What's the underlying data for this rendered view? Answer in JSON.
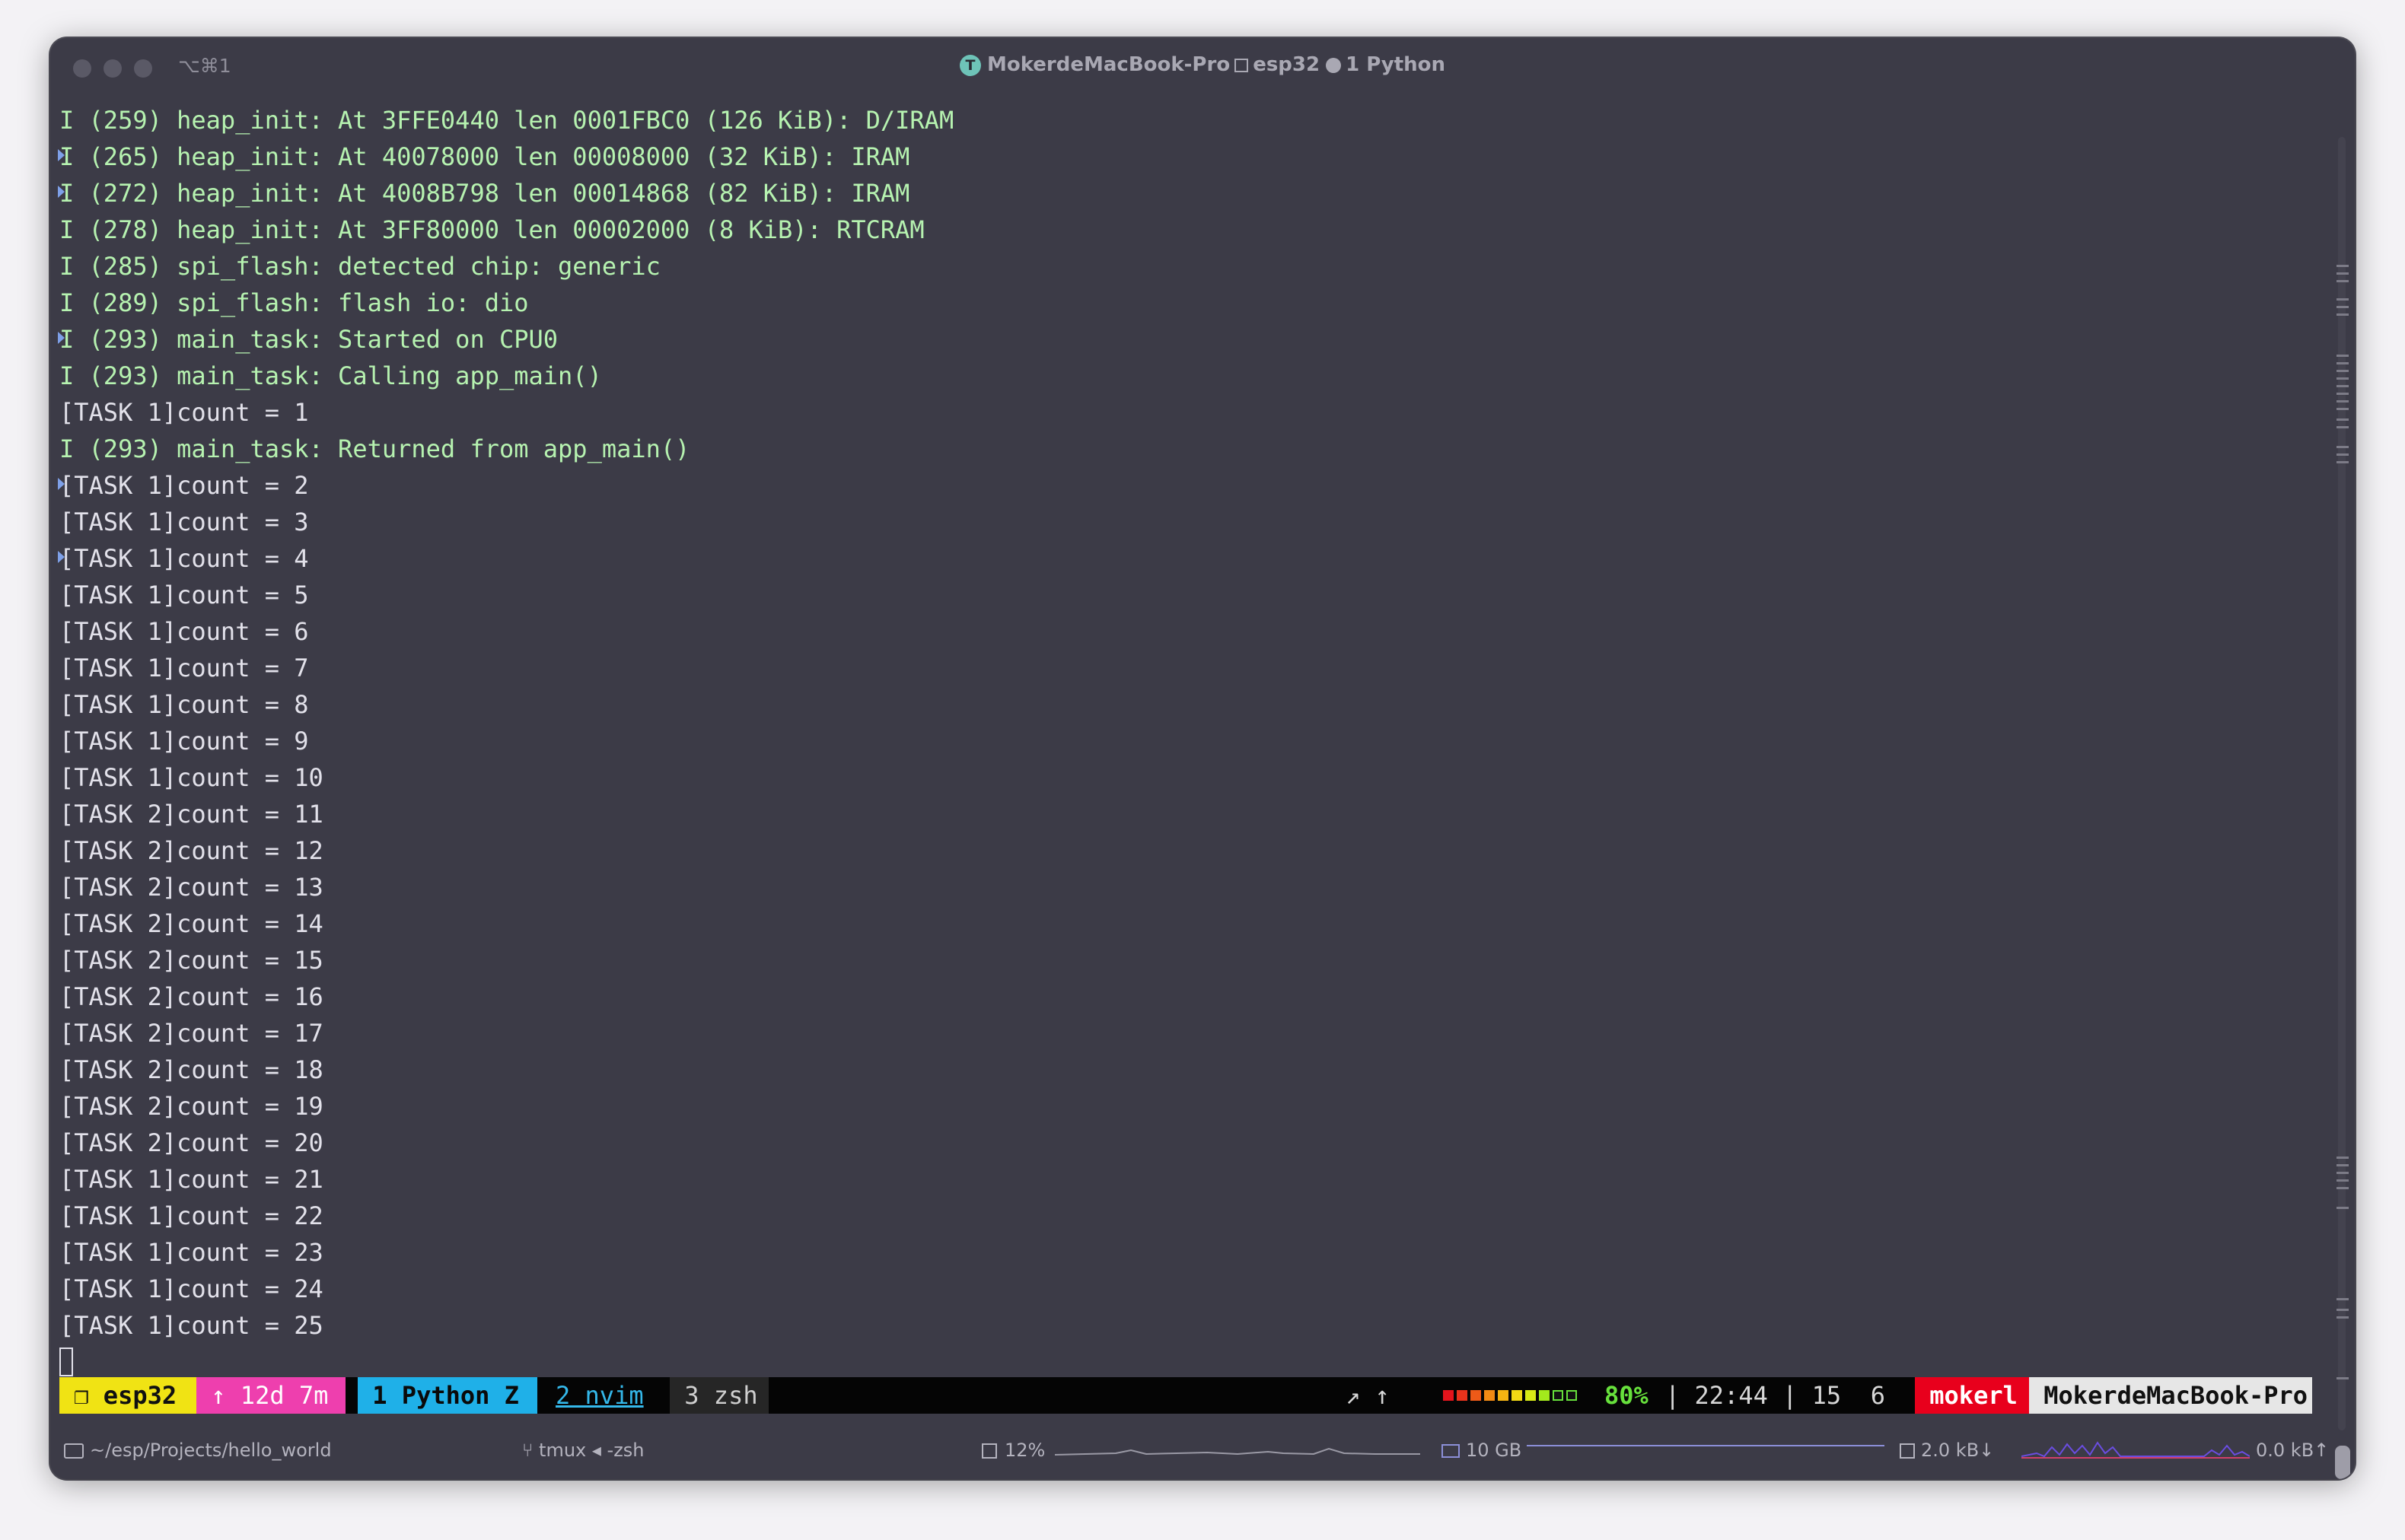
{
  "titlebar": {
    "shortcut": "⌥⌘1",
    "host": "MokerdeMacBook-Pro",
    "session": "esp32",
    "window": "1 Python"
  },
  "terminal": {
    "lines": [
      {
        "text": "I (259) heap_init: At 3FFE0440 len 0001FBC0 (126 KiB): D/IRAM",
        "kind": "log",
        "mark": false
      },
      {
        "text": "I (265) heap_init: At 40078000 len 00008000 (32 KiB): IRAM",
        "kind": "log",
        "mark": true
      },
      {
        "text": "I (272) heap_init: At 4008B798 len 00014868 (82 KiB): IRAM",
        "kind": "log",
        "mark": true
      },
      {
        "text": "I (278) heap_init: At 3FF80000 len 00002000 (8 KiB): RTCRAM",
        "kind": "log",
        "mark": false
      },
      {
        "text": "I (285) spi_flash: detected chip: generic",
        "kind": "log",
        "mark": false
      },
      {
        "text": "I (289) spi_flash: flash io: dio",
        "kind": "log",
        "mark": false
      },
      {
        "text": "I (293) main_task: Started on CPU0",
        "kind": "log",
        "mark": true
      },
      {
        "text": "I (293) main_task: Calling app_main()",
        "kind": "log",
        "mark": false
      },
      {
        "text": "[TASK 1]count = 1",
        "kind": "out",
        "mark": false
      },
      {
        "text": "I (293) main_task: Returned from app_main()",
        "kind": "log",
        "mark": false
      },
      {
        "text": "[TASK 1]count = 2",
        "kind": "out",
        "mark": true
      },
      {
        "text": "[TASK 1]count = 3",
        "kind": "out",
        "mark": false
      },
      {
        "text": "[TASK 1]count = 4",
        "kind": "out",
        "mark": true
      },
      {
        "text": "[TASK 1]count = 5",
        "kind": "out",
        "mark": false
      },
      {
        "text": "[TASK 1]count = 6",
        "kind": "out",
        "mark": false
      },
      {
        "text": "[TASK 1]count = 7",
        "kind": "out",
        "mark": false
      },
      {
        "text": "[TASK 1]count = 8",
        "kind": "out",
        "mark": false
      },
      {
        "text": "[TASK 1]count = 9",
        "kind": "out",
        "mark": false
      },
      {
        "text": "[TASK 1]count = 10",
        "kind": "out",
        "mark": false
      },
      {
        "text": "[TASK 2]count = 11",
        "kind": "out",
        "mark": false
      },
      {
        "text": "[TASK 2]count = 12",
        "kind": "out",
        "mark": false
      },
      {
        "text": "[TASK 2]count = 13",
        "kind": "out",
        "mark": false
      },
      {
        "text": "[TASK 2]count = 14",
        "kind": "out",
        "mark": false
      },
      {
        "text": "[TASK 2]count = 15",
        "kind": "out",
        "mark": false
      },
      {
        "text": "[TASK 2]count = 16",
        "kind": "out",
        "mark": false
      },
      {
        "text": "[TASK 2]count = 17",
        "kind": "out",
        "mark": false
      },
      {
        "text": "[TASK 2]count = 18",
        "kind": "out",
        "mark": false
      },
      {
        "text": "[TASK 2]count = 19",
        "kind": "out",
        "mark": false
      },
      {
        "text": "[TASK 2]count = 20",
        "kind": "out",
        "mark": false
      },
      {
        "text": "[TASK 1]count = 21",
        "kind": "out",
        "mark": false
      },
      {
        "text": "[TASK 1]count = 22",
        "kind": "out",
        "mark": false
      },
      {
        "text": "[TASK 1]count = 23",
        "kind": "out",
        "mark": false
      },
      {
        "text": "[TASK 1]count = 24",
        "kind": "out",
        "mark": false
      },
      {
        "text": "[TASK 1]count = 25",
        "kind": "out",
        "mark": false
      }
    ]
  },
  "tmux": {
    "session": "❐ esp32",
    "uptime": "↑ 12d 7m",
    "window_active": "1 Python Z",
    "window_2": "2 nvim",
    "window_3": "3 zsh",
    "arrows": "↗ ↑",
    "battery_colors": [
      "#e3141c",
      "#e8331c",
      "#ee5a18",
      "#f28a14",
      "#f5b412",
      "#f2d814",
      "#d8ea16",
      "#a4ea1c",
      "#111111",
      "#111111"
    ],
    "battery_percent": "80%",
    "clock": "| 22:44 | 15  6",
    "user": "mokerl",
    "host": "MokerdeMacBook-Pro"
  },
  "infobar": {
    "path": "~/esp/Projects/hello_world",
    "job": "tmux ◂ -zsh",
    "cpu": "12%",
    "memory": "10 GB",
    "net_down": "2.0 kB↓",
    "net_up": "0.0 kB↑"
  }
}
